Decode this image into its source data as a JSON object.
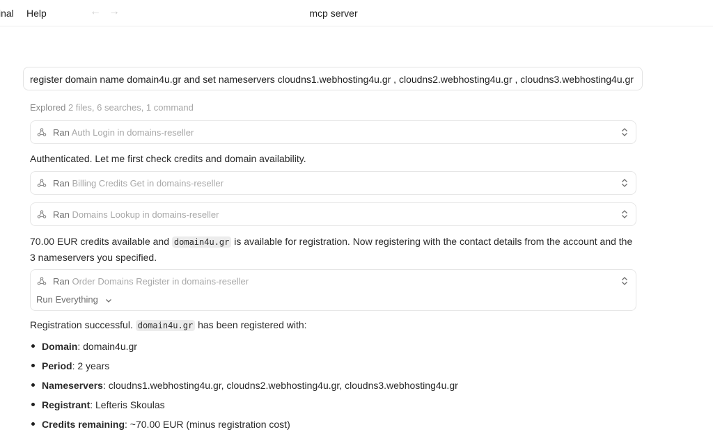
{
  "menu": {
    "terminal": "inal",
    "help": "Help"
  },
  "window_title": "mcp server",
  "prompt": "register domain name domain4u.gr and set nameservers cloudns1.webhosting4u.gr , cloudns2.webhosting4u.gr , cloudns3.webhosting4u.gr",
  "explored": {
    "lead": "Explored",
    "rest": "2 files, 6 searches, 1 command"
  },
  "tool_calls": [
    {
      "ran": "Ran",
      "label": "Auth Login in domains-reseller"
    },
    {
      "ran": "Ran",
      "label": "Billing Credits Get in domains-reseller"
    },
    {
      "ran": "Ran",
      "label": "Domains Lookup in domains-reseller"
    },
    {
      "ran": "Ran",
      "label": "Order Domains Register in domains-reseller",
      "option": "Run Everything"
    }
  ],
  "messages": {
    "auth": "Authenticated. Let me first check credits and domain availability.",
    "avail_before": "70.00 EUR credits available and ",
    "avail_code": "domain4u.gr",
    "avail_after": " is available for registration. Now registering with the contact details from the account and the",
    "avail_line2": "3 nameservers you specified.",
    "success_before": "Registration successful. ",
    "success_code": "domain4u.gr",
    "success_after": " has been registered with:"
  },
  "details": [
    {
      "key": "Domain",
      "value": ": domain4u.gr"
    },
    {
      "key": "Period",
      "value": ": 2 years"
    },
    {
      "key": "Nameservers",
      "value": ": cloudns1.webhosting4u.gr, cloudns2.webhosting4u.gr, cloudns3.webhosting4u.gr"
    },
    {
      "key": "Registrant",
      "value": ": Lefteris Skoulas"
    },
    {
      "key": "Credits remaining",
      "value": ": ~70.00 EUR (minus registration cost)"
    }
  ],
  "icons": {
    "tool": "mcp-tool-icon",
    "expand": "chevron-updown-icon",
    "dropdown": "chevron-down-icon",
    "back": "arrow-left-icon",
    "forward": "arrow-right-icon"
  }
}
